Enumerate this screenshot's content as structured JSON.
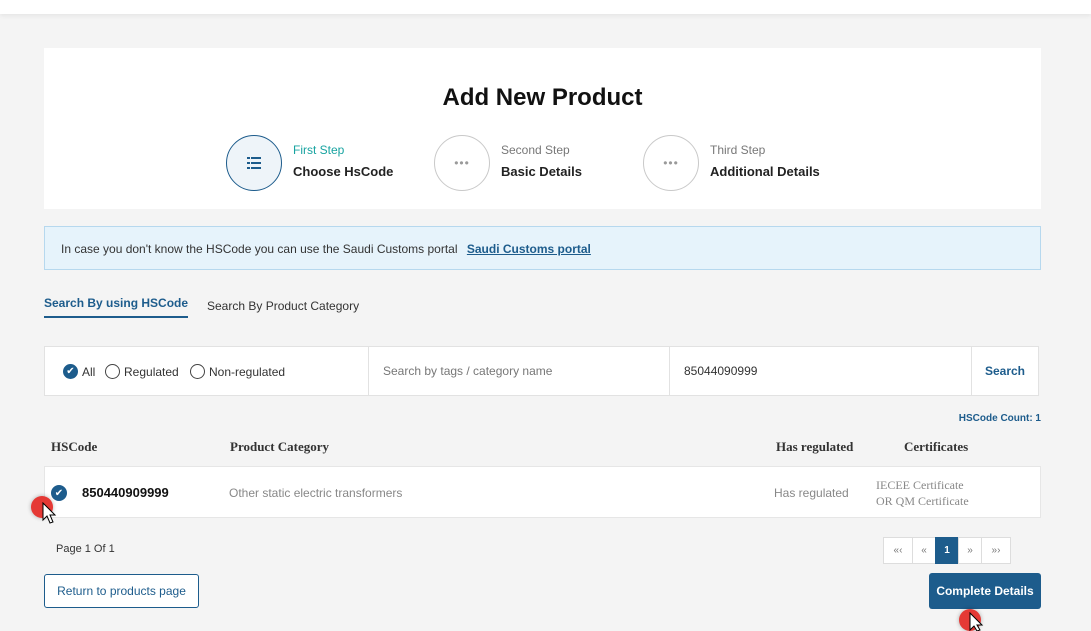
{
  "header": {
    "title": "Add New Product",
    "steps": [
      {
        "num": "First Step",
        "name": "Choose HsCode",
        "icon": "list-icon",
        "state": "active"
      },
      {
        "num": "Second Step",
        "name": "Basic Details",
        "icon": "ellipsis-icon",
        "state": "pending"
      },
      {
        "num": "Third Step",
        "name": "Additional Details",
        "icon": "ellipsis-icon",
        "state": "pending"
      }
    ]
  },
  "banner": {
    "text": "In case you don't know the HSCode you can use the Saudi Customs portal",
    "link": "Saudi Customs portal"
  },
  "tabs": [
    {
      "label": "Search By using HSCode",
      "active": true
    },
    {
      "label": "Search By Product Category",
      "active": false
    }
  ],
  "filters": {
    "options": [
      {
        "label": "All",
        "checked": true
      },
      {
        "label": "Regulated",
        "checked": false
      },
      {
        "label": "Non-regulated",
        "checked": false
      }
    ],
    "tags_placeholder": "Search by tags / category name",
    "code_value": "85044090999",
    "search_label": "Search"
  },
  "count_label": "HSCode Count: 1",
  "table": {
    "headers": [
      "HSCode",
      "Product Category",
      "Has regulated",
      "Certificates"
    ],
    "rows": [
      {
        "selected": true,
        "code": "850440909999",
        "category": "Other static electric transformers",
        "regulated": "Has regulated",
        "cert_line1": "IECEE Certificate",
        "cert_line2": "OR QM Certificate"
      }
    ]
  },
  "pagination": {
    "info": "Page 1 Of 1",
    "first": "«‹",
    "prev": "«",
    "current": "1",
    "next": "»",
    "last": "»›"
  },
  "actions": {
    "return_label": "Return to products page",
    "complete_label": "Complete Details"
  },
  "colors": {
    "accent": "#1d5c8c",
    "step_active": "#17a3a0",
    "banner_bg": "#e6f3fb",
    "click_marker": "#e53935"
  }
}
